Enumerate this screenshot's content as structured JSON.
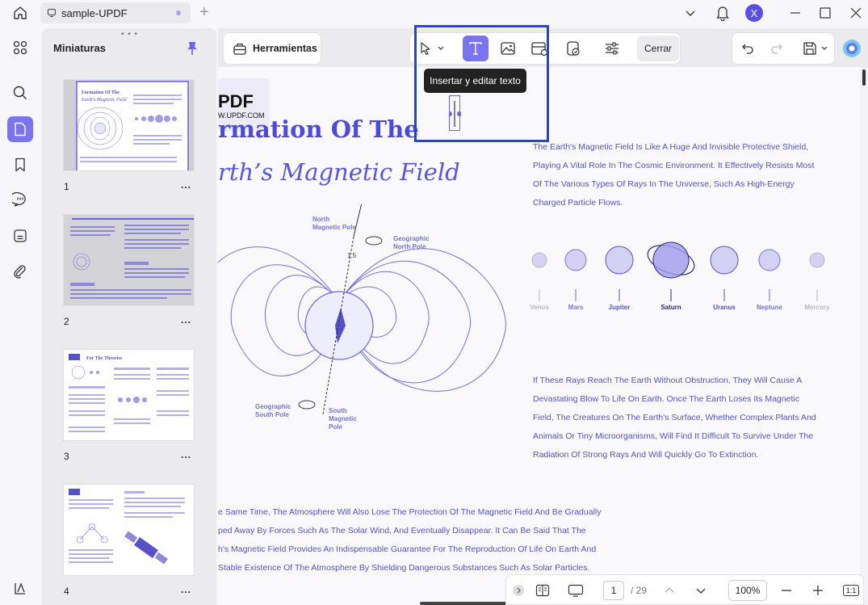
{
  "titlebar": {
    "tab_label": "sample-UPDF",
    "avatar_letter": "X"
  },
  "panel": {
    "title": "Miniaturas",
    "more": "...",
    "thumbnails": [
      {
        "page": "1",
        "heading": "Formation Of The",
        "subheading": "Earth's Magnetic Field"
      },
      {
        "page": "2"
      },
      {
        "page": "3",
        "heading": "For The Theories"
      },
      {
        "page": "4"
      }
    ]
  },
  "toolbar": {
    "tools_label": "Herramientas",
    "close_label": "Cerrar",
    "tooltip": "Insertar y editar texto"
  },
  "document": {
    "logo": "PDF",
    "logo_sub": "W.UPDF.COM",
    "heading1": "rmation Of The",
    "heading2": "rth’s Magnetic Field",
    "para1": [
      "The Earth's Magnetic Field Is Like A Huge And Invisible Protective Shield,",
      "Playing A Vital Role In The Cosmic Environment. It Effectively Resists Most",
      "Of The Various Types Of Rays In The Universe, Such As High-Energy",
      "Charged Particle Flows."
    ],
    "planets": [
      {
        "name": "Venus",
        "r": 9,
        "color": "#b9b9bd"
      },
      {
        "name": "Mars",
        "r": 13,
        "color": "#7572d8"
      },
      {
        "name": "Jupiter",
        "r": 17,
        "color": "#5552c9"
      },
      {
        "name": "Saturn",
        "r": 22,
        "color": "#2d2a7c"
      },
      {
        "name": "Uranus",
        "r": 17,
        "color": "#5552c9"
      },
      {
        "name": "Neptune",
        "r": 13,
        "color": "#7572d8"
      },
      {
        "name": "Mercury",
        "r": 9,
        "color": "#b9b9bd"
      }
    ],
    "diagram": {
      "north_magnetic": [
        "North",
        "Magnetic Pole"
      ],
      "geo_north": [
        "Geographic",
        "North Pole"
      ],
      "angle": "1.5",
      "geo_south": [
        "Geographic",
        "South Pole"
      ],
      "south_magnetic": [
        "South",
        "Magnetic",
        "Pole"
      ]
    },
    "para2": [
      "If These Rays Reach The Earth Without Obstruction, They Will Cause A",
      "Devastating Blow To Life On Earth. Once The Earth Loses Its Magnetic",
      "Field, The Creatures On The Earth's Surface, Whether Complex Plants And",
      "Animals Or Tiny Microorganisms, Will Find It Difficult To Survive Under The",
      "Radiation Of Strong Rays And Will Quickly Go To Extinction."
    ],
    "para3": [
      "e Same Time, The Atmosphere Will Also Lose The Protection Of The Magnetic Field And Be Gradually",
      "ped Away By Forces Such As The Solar Wind, And Eventually Disappear. It Can Be Said That The",
      "h's Magnetic Field Provides An Indispensable Guarantee For The Reproduction Of Life On Earth And",
      "Stable Existence Of The Atmosphere By Shielding Dangerous Substances Such As Solar Particles."
    ]
  },
  "bottombar": {
    "current_page": "1",
    "total_pages": "/ 29",
    "zoom": "100%",
    "fit_label": "1:1"
  }
}
